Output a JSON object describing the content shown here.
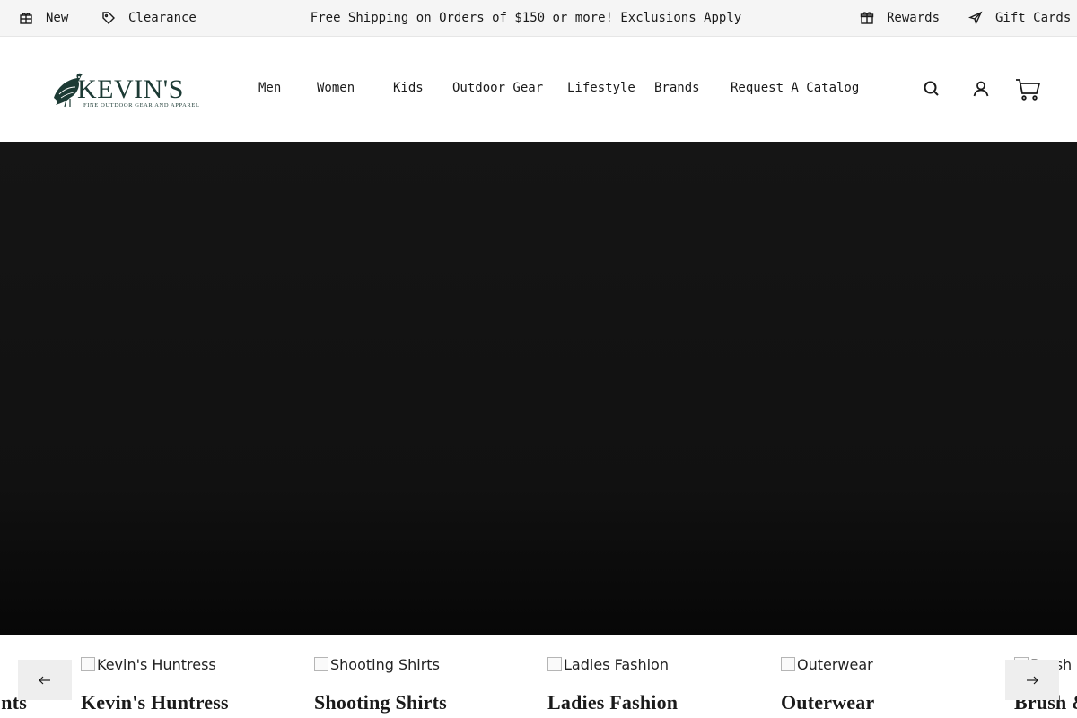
{
  "announcement": {
    "new_label": "New",
    "clearance_label": "Clearance",
    "promo_text": "Free Shipping on Orders of $150 or more! Exclusions Apply",
    "rewards_label": "Rewards",
    "gift_cards_label": "Gift Cards"
  },
  "header": {
    "logo_word": "KEVIN'S",
    "logo_tagline": "FINE OUTDOOR GEAR AND APPAREL",
    "nav": [
      "Men",
      "Women",
      "Kids",
      "Outdoor Gear",
      "Lifestyle",
      "Brands",
      "Request A Catalog"
    ],
    "icons": [
      "search-icon",
      "account-icon",
      "cart-icon"
    ]
  },
  "colors": {
    "brand_green": "#1d3b35",
    "topbar_bg": "#f5f5f5",
    "hero_bg": "#111111"
  },
  "categories": [
    {
      "alt": "",
      "title": "nts"
    },
    {
      "alt": "Kevin's Huntress",
      "title": "Kevin's Huntress"
    },
    {
      "alt": "Shooting Shirts",
      "title": "Shooting Shirts"
    },
    {
      "alt": "Ladies Fashion",
      "title": "Ladies Fashion"
    },
    {
      "alt": "Outerwear",
      "title": "Outerwear"
    },
    {
      "alt": "Brush &",
      "title": "Brush &"
    }
  ],
  "carousel": {
    "prev_icon": "arrow-left-icon",
    "next_icon": "arrow-right-icon"
  }
}
